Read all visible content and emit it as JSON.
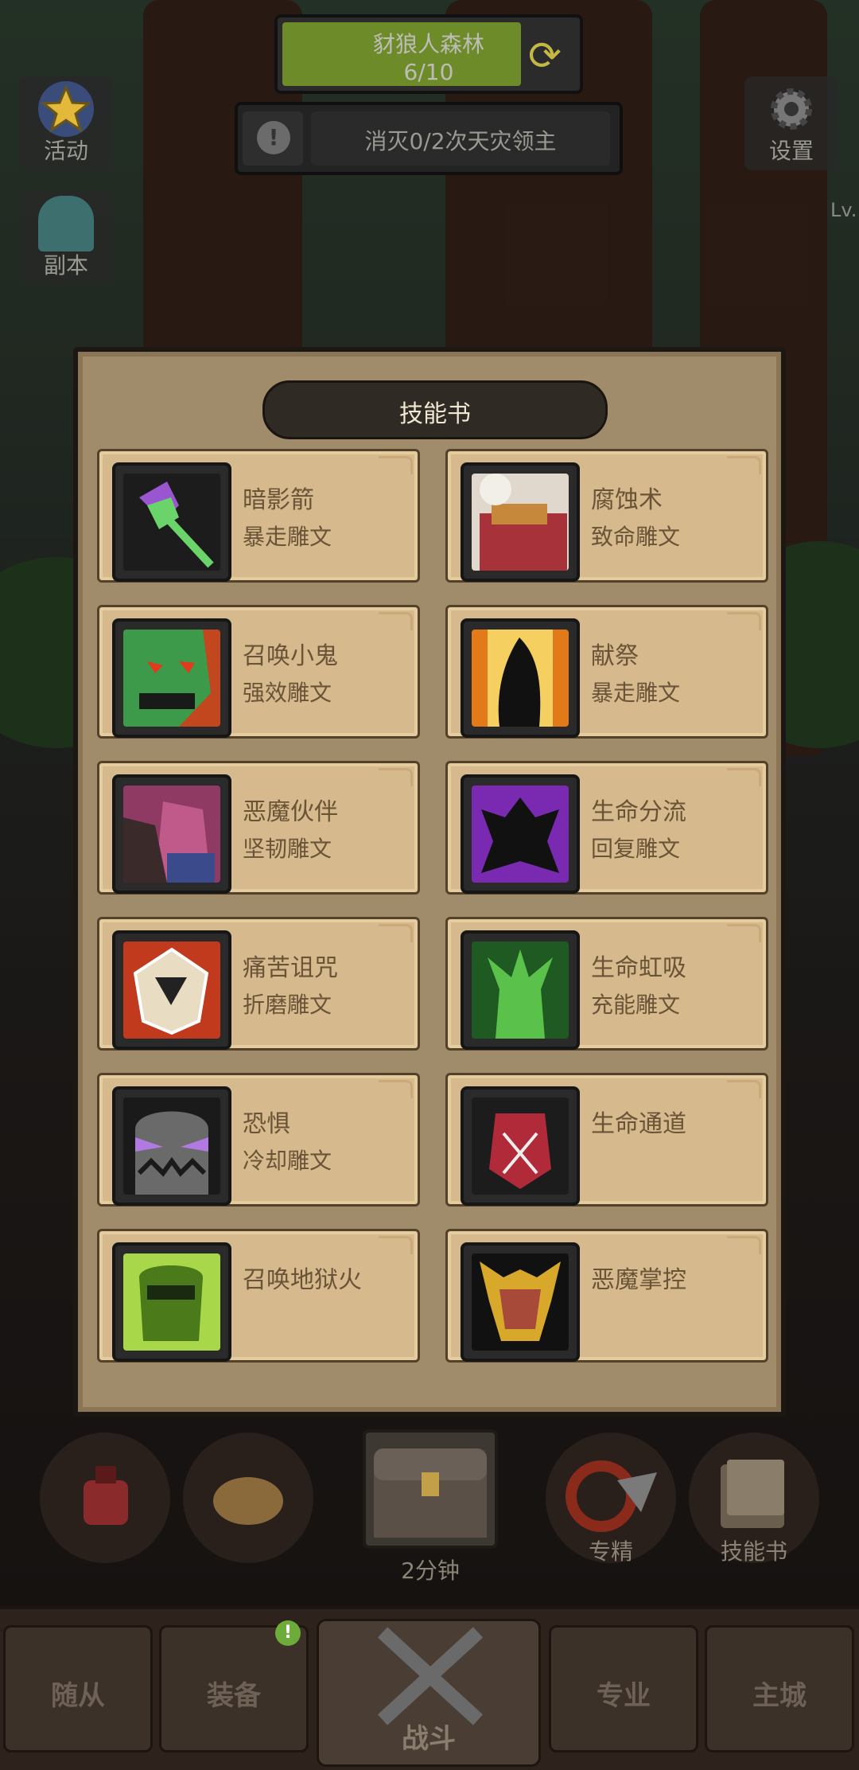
{
  "hud": {
    "zone_name": "豺狼人森林",
    "zone_progress": "6/10",
    "quest_text": "消灭0/2次天灾领主",
    "activity_label": "活动",
    "dungeon_label": "副本",
    "settings_label": "设置",
    "level_label": "Lv."
  },
  "modal": {
    "title": "技能书",
    "skills": [
      {
        "name": "暗影箭",
        "rune": "暴走雕文",
        "icon": "shadow-bolt-icon",
        "color": "#7a3fb0"
      },
      {
        "name": "腐蚀术",
        "rune": "致命雕文",
        "icon": "corruption-icon",
        "color": "#a8323a"
      },
      {
        "name": "召唤小鬼",
        "rune": "强效雕文",
        "icon": "imp-icon",
        "color": "#3c9a4a"
      },
      {
        "name": "献祭",
        "rune": "暴走雕文",
        "icon": "immolate-icon",
        "color": "#e27a1a"
      },
      {
        "name": "恶魔伙伴",
        "rune": "坚韧雕文",
        "icon": "demon-companion-icon",
        "color": "#8e3a63"
      },
      {
        "name": "生命分流",
        "rune": "回复雕文",
        "icon": "life-tap-icon",
        "color": "#7a2ab0"
      },
      {
        "name": "痛苦诅咒",
        "rune": "折磨雕文",
        "icon": "curse-of-agony-icon",
        "color": "#c23a1e"
      },
      {
        "name": "生命虹吸",
        "rune": "充能雕文",
        "icon": "siphon-life-icon",
        "color": "#3a8c2e"
      },
      {
        "name": "恐惧",
        "rune": "冷却雕文",
        "icon": "fear-icon",
        "color": "#6a6a6a"
      },
      {
        "name": "生命通道",
        "rune": "",
        "icon": "health-funnel-icon",
        "color": "#b02a3a"
      },
      {
        "name": "召唤地狱火",
        "rune": "",
        "icon": "infernal-icon",
        "color": "#7ab82a"
      },
      {
        "name": "恶魔掌控",
        "rune": "",
        "icon": "demonic-control-icon",
        "color": "#d8a82a"
      }
    ]
  },
  "actions": {
    "chest_timer": "2分钟",
    "specialization_label": "专精",
    "skillbook_label": "技能书"
  },
  "nav": {
    "followers": "随从",
    "equipment": "装备",
    "battle": "战斗",
    "profession": "专业",
    "main_city": "主城",
    "equipment_badge": "!"
  }
}
